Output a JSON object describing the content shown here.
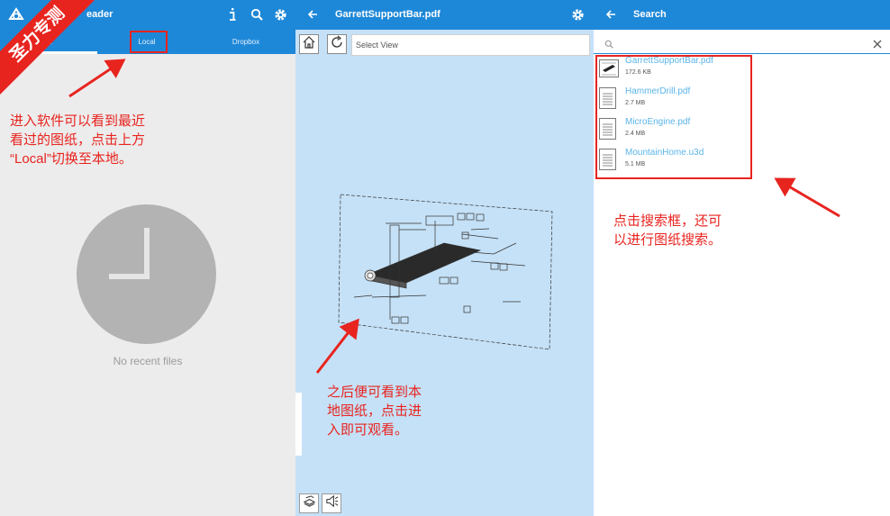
{
  "panel1": {
    "title": "eader",
    "tabs": {
      "recent": "nt",
      "local": "Local",
      "dropbox": "Dropbox"
    },
    "empty_text": "No recent files",
    "icons": [
      "app-logo-icon",
      "info-icon",
      "search-icon",
      "gear-icon"
    ]
  },
  "panel2": {
    "title": "GarrettSupportBar.pdf",
    "view_select": "Select View",
    "icons": [
      "back-arrow-icon",
      "gear-icon",
      "home-icon",
      "refresh-icon",
      "layers-icon",
      "speaker-icon"
    ]
  },
  "panel3": {
    "title": "Search",
    "files": [
      {
        "name": "GarrettSupportBar.pdf",
        "size": "172.6 KB",
        "icon": "drawing-thumbnail-icon"
      },
      {
        "name": "HammerDrill.pdf",
        "size": "2.7 MB",
        "icon": "document-icon"
      },
      {
        "name": "MicroEngine.pdf",
        "size": "2.4 MB",
        "icon": "document-icon"
      },
      {
        "name": "MountainHome.u3d",
        "size": "5.1 MB",
        "icon": "document-icon"
      }
    ],
    "icons": [
      "back-arrow-icon",
      "search-icon",
      "close-icon"
    ]
  },
  "annotations": {
    "watermark": "圣力专测",
    "note1": [
      "进入软件可以看到最近",
      "看过的图纸，点击上方",
      "“Local”切换至本地。"
    ],
    "note2": [
      "之后便可看到本",
      "地图纸，点击进",
      "入即可观看。"
    ],
    "note3": [
      "点击搜索框，还可",
      "以进行图纸搜索。"
    ]
  },
  "colors": {
    "appbar": "#1e88d8",
    "annotation": "#e8241f",
    "viewer_bg": "#c5e1f7",
    "link": "#5ab4e8"
  }
}
